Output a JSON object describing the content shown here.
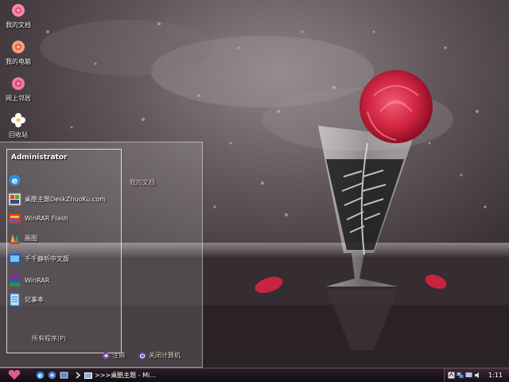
{
  "desktop": {
    "icons": [
      {
        "label": "我的文档",
        "icon": "my-documents-rose-icon"
      },
      {
        "label": "我的电脑",
        "icon": "my-computer-rose-icon"
      },
      {
        "label": "网上邻居",
        "icon": "network-rose-icon"
      },
      {
        "label": "回收站",
        "icon": "recycle-bin-flower-icon"
      }
    ]
  },
  "start_menu": {
    "user_name": "Administrator",
    "items": [
      {
        "label": "",
        "icon": "internet-explorer-icon"
      },
      {
        "label": "桌酷主题DeskZhuoKu.com",
        "icon": "deskzhuoku-icon"
      },
      {
        "label": "WinRAR Flash",
        "icon": "media-player-icon"
      },
      {
        "label": "画图",
        "icon": "paint-icon"
      },
      {
        "label": "千千静听中文版",
        "icon": "ttplayer-icon"
      },
      {
        "label": "WinRAR",
        "icon": "winrar-icon"
      },
      {
        "label": "记事本",
        "icon": "notepad-icon"
      }
    ],
    "all_programs": "所有程序(P)",
    "right_links": [
      {
        "label": "我的文档"
      }
    ],
    "actions": {
      "logoff": "注销",
      "shutdown": "关闭计算机"
    }
  },
  "taskbar": {
    "quick_launch": [
      "ie-icon",
      "media-icon",
      "desktop-icon"
    ],
    "task_label": ">>>桌酷主题 - Mi...",
    "clock": "1:11"
  },
  "colors": {
    "rose": "#d9304a",
    "taskbar": "#1a1016",
    "accent": "#8a5a9a"
  }
}
